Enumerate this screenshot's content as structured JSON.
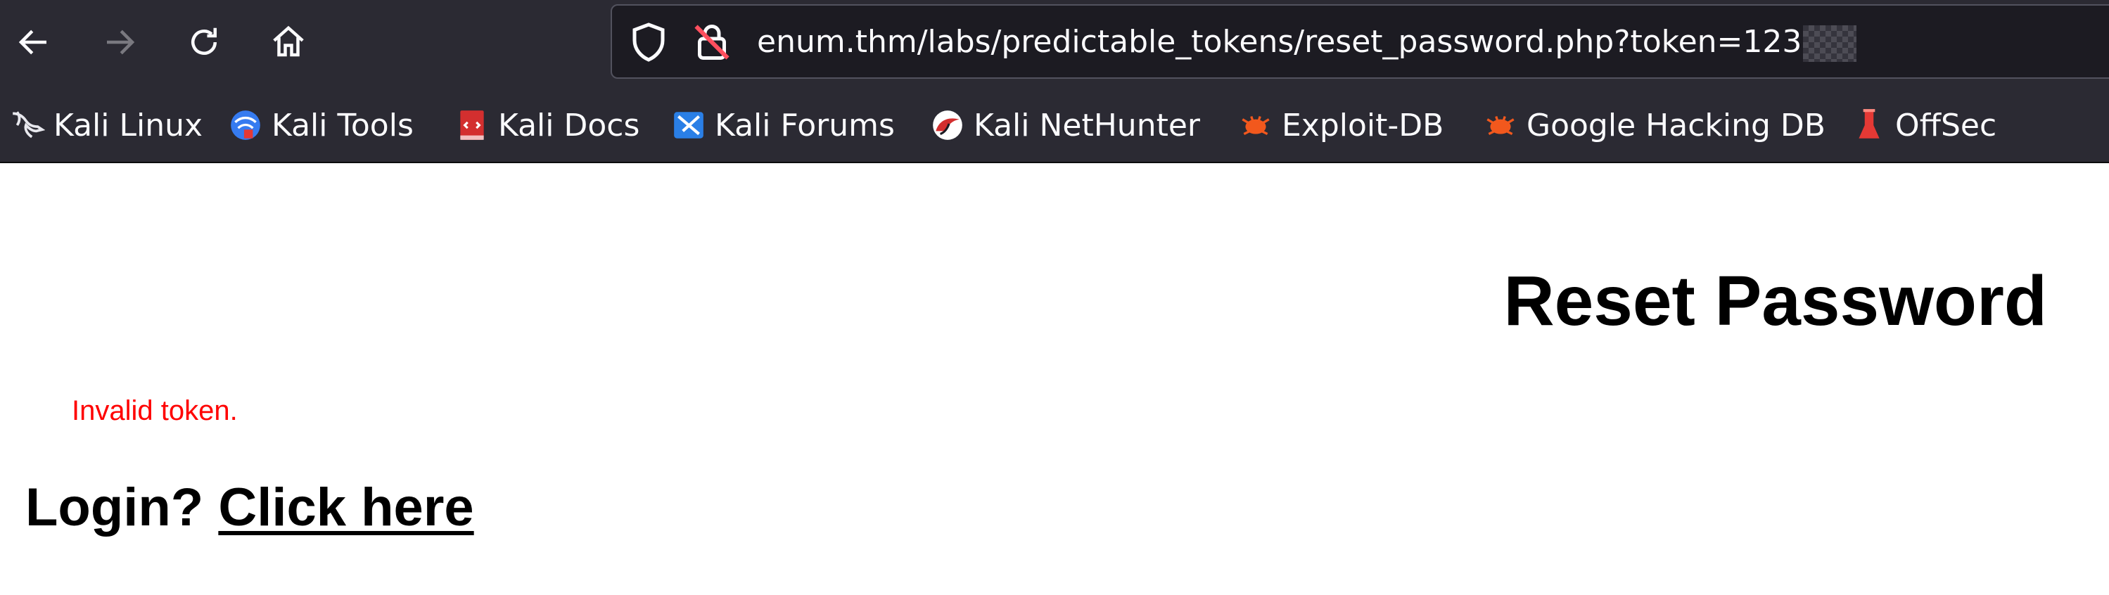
{
  "browser": {
    "url": "enum.thm/labs/predictable_tokens/reset_password.php?token=123",
    "bookmarks": [
      {
        "label": "Kali Linux",
        "icon": "kali-dragon-icon"
      },
      {
        "label": "Kali Tools",
        "icon": "kali-tools-icon"
      },
      {
        "label": "Kali Docs",
        "icon": "kali-docs-icon"
      },
      {
        "label": "Kali Forums",
        "icon": "kali-forums-icon"
      },
      {
        "label": "Kali NetHunter",
        "icon": "kali-nethunter-icon"
      },
      {
        "label": "Exploit-DB",
        "icon": "exploit-db-icon"
      },
      {
        "label": "Google Hacking DB",
        "icon": "ghdb-icon"
      },
      {
        "label": "OffSec",
        "icon": "offsec-icon"
      }
    ],
    "colors": {
      "chrome_bg": "#2b2a33",
      "urlbar_bg": "#1c1b22",
      "text": "#fbfbfe"
    }
  },
  "page": {
    "title": "Reset Password",
    "error": "Invalid token.",
    "login_prompt": "Login?",
    "login_link": "Click here",
    "colors": {
      "error": "#ff0000",
      "text": "#000000"
    }
  }
}
